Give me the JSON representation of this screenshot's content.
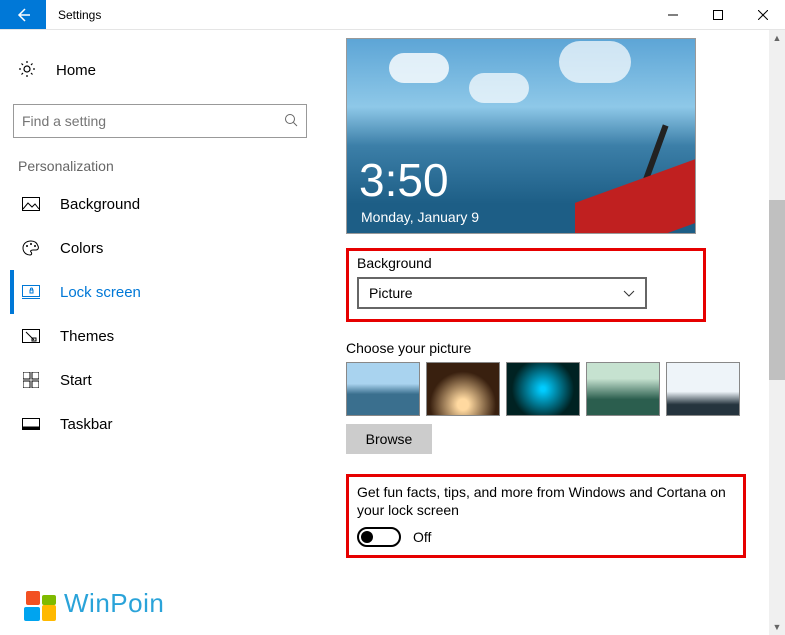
{
  "window": {
    "title": "Settings"
  },
  "sidebar": {
    "home": "Home",
    "search_placeholder": "Find a setting",
    "section": "Personalization",
    "items": [
      {
        "label": "Background"
      },
      {
        "label": "Colors"
      },
      {
        "label": "Lock screen"
      },
      {
        "label": "Themes"
      },
      {
        "label": "Start"
      },
      {
        "label": "Taskbar"
      }
    ],
    "active_index": 2
  },
  "preview": {
    "time": "3:50",
    "date": "Monday, January 9"
  },
  "background_section": {
    "label": "Background",
    "dropdown_value": "Picture"
  },
  "picture_section": {
    "label": "Choose your picture",
    "browse": "Browse"
  },
  "funfacts": {
    "text": "Get fun facts, tips, and more from Windows and Cortana on your lock screen",
    "state": "Off",
    "enabled": false
  },
  "branding": {
    "name": "WinPoin"
  }
}
